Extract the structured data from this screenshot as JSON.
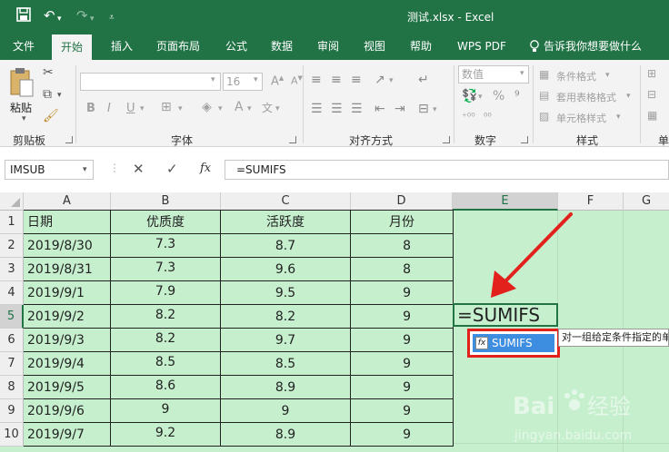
{
  "titlebar": {
    "title": "测试.xlsx  -  Excel",
    "save_icon": "save-icon",
    "undo_icon": "undo-icon",
    "redo_icon": "redo-icon",
    "customize_icon": "customize-quick-access-icon"
  },
  "tabs": [
    {
      "label": "文件"
    },
    {
      "label": "开始"
    },
    {
      "label": "插入"
    },
    {
      "label": "页面布局"
    },
    {
      "label": "公式"
    },
    {
      "label": "数据"
    },
    {
      "label": "审阅"
    },
    {
      "label": "视图"
    },
    {
      "label": "帮助"
    },
    {
      "label": "WPS PDF"
    },
    {
      "label": "告诉我你想要做什么"
    }
  ],
  "ribbon": {
    "clipboard": {
      "paste_label": "粘贴",
      "group_label": "剪贴板"
    },
    "font": {
      "size_value": "16",
      "group_label": "字体",
      "bold": "B",
      "italic": "I",
      "underline": "U"
    },
    "alignment": {
      "group_label": "对齐方式"
    },
    "number": {
      "format_value": "数值",
      "group_label": "数字",
      "percent": "%"
    },
    "styles": {
      "conditional_format": "条件格式",
      "table_format": "套用表格格式",
      "cell_style": "单元格样式",
      "group_label": "样式"
    },
    "cells": {
      "group_label_partial": "单"
    }
  },
  "formula_bar": {
    "name_box": "IMSUB",
    "fx_label": "fx",
    "content": "=SUMIFS"
  },
  "sheet": {
    "columns": [
      "A",
      "B",
      "C",
      "D",
      "E",
      "F",
      "G"
    ],
    "selected_column": "E",
    "rows": [
      "1",
      "2",
      "3",
      "4",
      "5",
      "6",
      "7",
      "8",
      "9",
      "10"
    ],
    "selected_row": "5",
    "headers": [
      "日期",
      "优质度",
      "活跃度",
      "月份"
    ],
    "data": [
      [
        "2019/8/30",
        "7.3",
        "8.7",
        "8"
      ],
      [
        "2019/8/31",
        "7.3",
        "9.6",
        "8"
      ],
      [
        "2019/9/1",
        "7.9",
        "9.5",
        "9"
      ],
      [
        "2019/9/2",
        "8.2",
        "8.2",
        "9"
      ],
      [
        "2019/9/3",
        "8.2",
        "9.7",
        "9"
      ],
      [
        "2019/9/4",
        "8.5",
        "8.5",
        "9"
      ],
      [
        "2019/9/5",
        "8.6",
        "8.9",
        "9"
      ],
      [
        "2019/9/6",
        "9",
        "9",
        "9"
      ],
      [
        "2019/9/7",
        "9.2",
        "8.9",
        "9"
      ]
    ],
    "active_cell_text": "=SUMIFS",
    "autocomplete_item": "SUMIFS",
    "autocomplete_icon": "function-icon",
    "tooltip": "对一组给定条件指定的单元格求和"
  },
  "watermark": {
    "brand_text": "Baidu经验",
    "sub_text": "jingyan.baidu.com"
  },
  "colors": {
    "excel_green": "#217346",
    "cell_fill": "#c6efce",
    "annotation_red": "#e2211c",
    "highlight_blue": "#3d8de0"
  }
}
